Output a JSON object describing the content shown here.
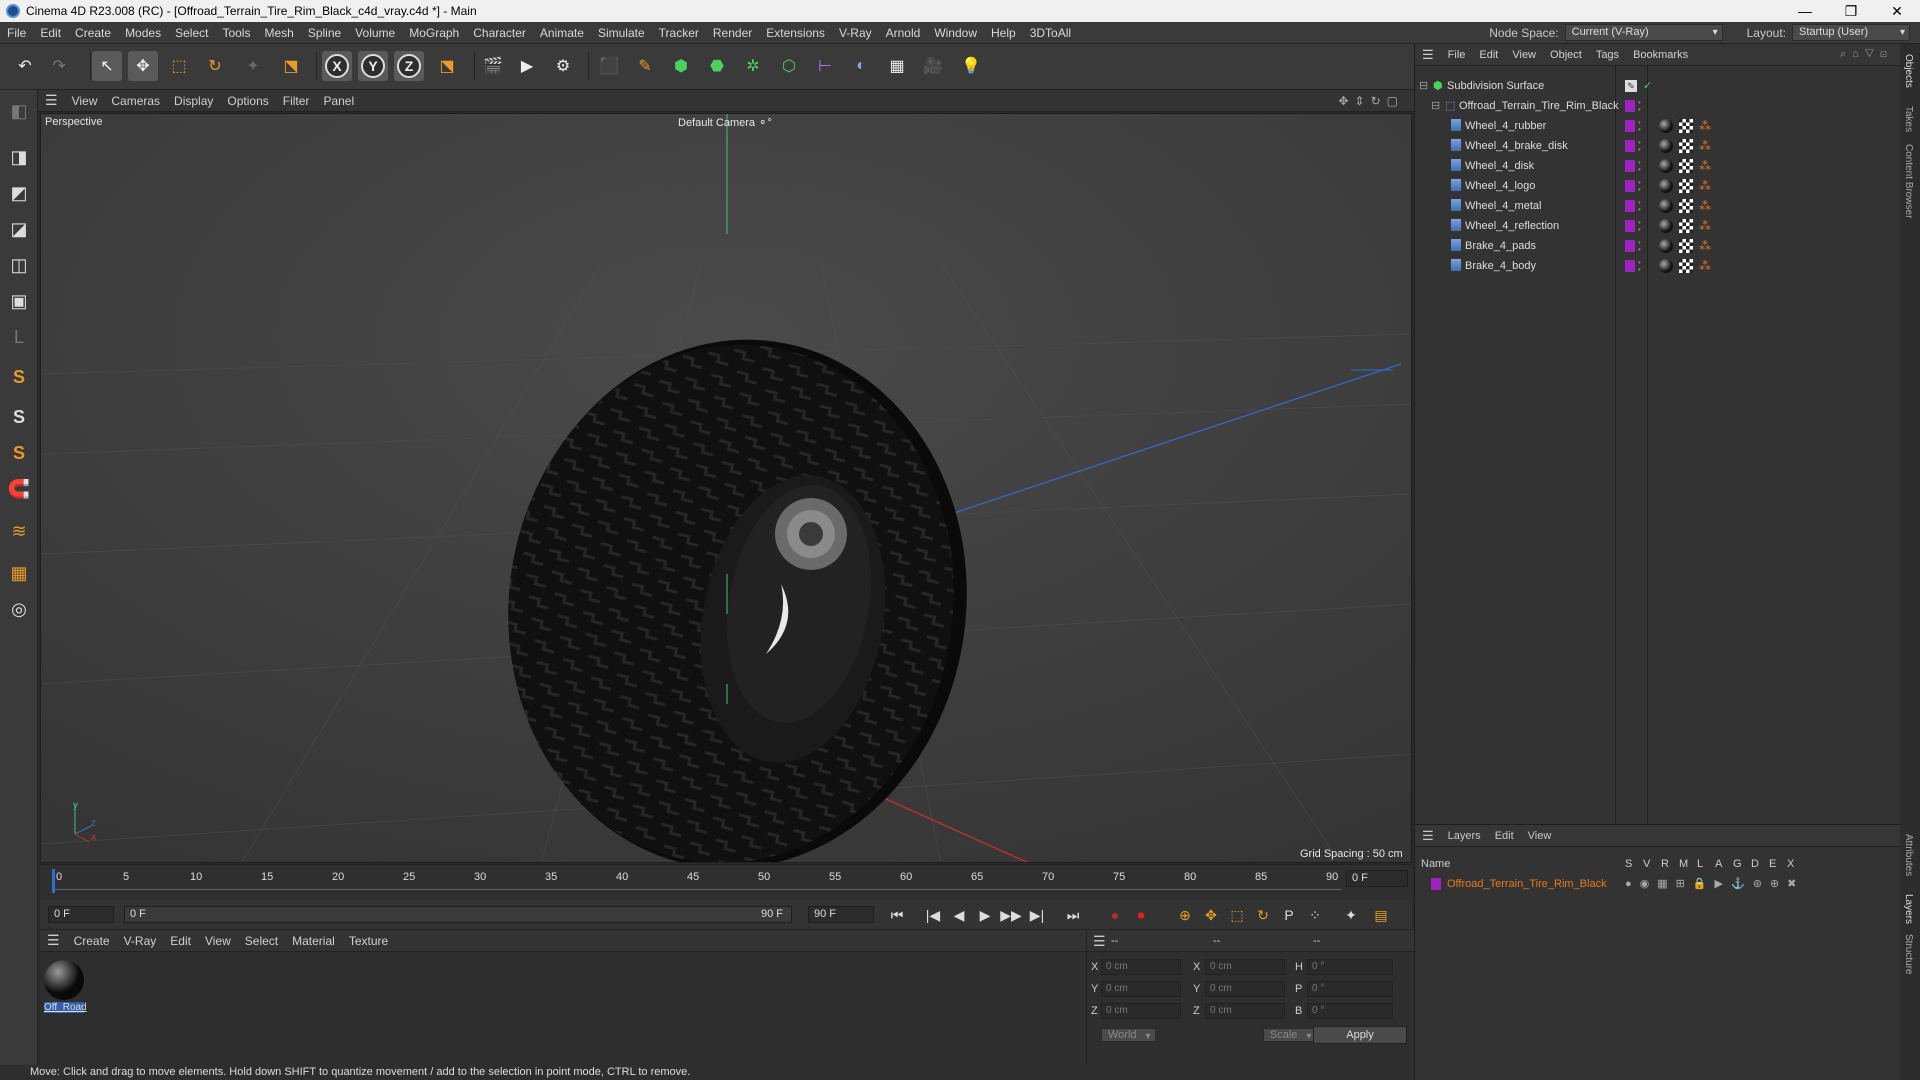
{
  "titlebar": {
    "title": "Cinema 4D R23.008 (RC) - [Offroad_Terrain_Tire_Rim_Black_c4d_vray.c4d *] - Main",
    "minimize": "—",
    "maximize": "❐",
    "close": "✕"
  },
  "menu": {
    "items": [
      "File",
      "Edit",
      "Create",
      "Modes",
      "Select",
      "Tools",
      "Mesh",
      "Spline",
      "Volume",
      "MoGraph",
      "Character",
      "Animate",
      "Simulate",
      "Tracker",
      "Render",
      "Extensions",
      "V-Ray",
      "Arnold",
      "Window",
      "Help",
      "3DToAll"
    ],
    "node_space_label": "Node Space:",
    "node_space_value": "Current (V-Ray)",
    "layout_label": "Layout:",
    "layout_value": "Startup (User)"
  },
  "toolbar": {
    "undo": "↶",
    "redo": "↷",
    "select": "↖",
    "move": "✥",
    "scale": "⬚",
    "rotate": "↻",
    "recent": "✦",
    "axis_x": "X",
    "axis_y": "Y",
    "axis_z": "Z",
    "coord": "⬔",
    "render_view": "🎬",
    "render_pic": "▶",
    "render_settings": "⚙",
    "cube": "⬛",
    "pen": "✎",
    "subdiv": "⬢",
    "extrude": "⬣",
    "cloner": "✲",
    "generators": "⬡",
    "deformer": "⊢",
    "field": "◐",
    "floor": "▦",
    "camera": "🎥",
    "light": "💡"
  },
  "lefttools": [
    "◧",
    "◨",
    "◩",
    "◪",
    "◫",
    "▣",
    "L",
    "S",
    "S",
    "S",
    "🧲",
    "≋",
    "▦",
    "◎"
  ],
  "viewport": {
    "menu": [
      "View",
      "Cameras",
      "Display",
      "Options",
      "Filter",
      "Panel"
    ],
    "label": "Perspective",
    "camera": "Default Camera",
    "camera_icon": "⚬°",
    "grid_spacing": "Grid Spacing : 50 cm",
    "axis_y": "y",
    "axis_z": "z",
    "axis_x": "x"
  },
  "timeline": {
    "ticks": [
      "0",
      "5",
      "10",
      "15",
      "20",
      "25",
      "30",
      "35",
      "40",
      "45",
      "50",
      "55",
      "60",
      "65",
      "70",
      "75",
      "80",
      "85",
      "90"
    ],
    "current_frame_right": "0 F",
    "start": "0 F",
    "range_start": "0 F",
    "range_end": "90 F",
    "end": "90 F"
  },
  "playbar": {
    "first": "⏮",
    "prev_key": "|◀",
    "prev": "◀",
    "play": "▶",
    "next": "▶|",
    "next_key": "▶▶",
    "last": "⏭",
    "record_auto": "●",
    "record": "⏺",
    "keys": [
      "⊕",
      "✥",
      "⬚",
      "↻",
      "P",
      "⁘"
    ],
    "options": [
      "✦",
      "▤"
    ]
  },
  "materials": {
    "menu": [
      "Create",
      "V-Ray",
      "Edit",
      "View",
      "Select",
      "Material",
      "Texture"
    ],
    "items": [
      {
        "name": "Off_Road"
      }
    ]
  },
  "coords": {
    "header": [
      "--",
      "--",
      "--"
    ],
    "rows": [
      {
        "a": "X",
        "av": "0 cm",
        "b": "X",
        "bv": "0 cm",
        "c": "H",
        "cv": "0 °"
      },
      {
        "a": "Y",
        "av": "0 cm",
        "b": "Y",
        "bv": "0 cm",
        "c": "P",
        "cv": "0 °"
      },
      {
        "a": "Z",
        "av": "0 cm",
        "b": "Z",
        "bv": "0 cm",
        "c": "B",
        "cv": "0 °"
      }
    ],
    "space": "World",
    "mode": "Scale",
    "apply": "Apply"
  },
  "status": "Move: Click and drag to move elements. Hold down SHIFT to quantize movement / add to the selection in point mode, CTRL to remove.",
  "objects": {
    "menu": [
      "File",
      "Edit",
      "View",
      "Object",
      "Tags",
      "Bookmarks"
    ],
    "tree": [
      {
        "name": "Subdivision Surface",
        "level": 0
      },
      {
        "name": "Offroad_Terrain_Tire_Rim_Black",
        "level": 1
      },
      {
        "name": "Wheel_4_rubber",
        "level": 2
      },
      {
        "name": "Wheel_4_brake_disk",
        "level": 2
      },
      {
        "name": "Wheel_4_disk",
        "level": 2
      },
      {
        "name": "Wheel_4_logo",
        "level": 2
      },
      {
        "name": "Wheel_4_metal",
        "level": 2
      },
      {
        "name": "Wheel_4_reflection",
        "level": 2
      },
      {
        "name": "Brake_4_pads",
        "level": 2
      },
      {
        "name": "Brake_4_body",
        "level": 2
      }
    ]
  },
  "layers": {
    "menu": [
      "Layers",
      "Edit",
      "View"
    ],
    "header_name": "Name",
    "columns": [
      "S",
      "V",
      "R",
      "M",
      "L",
      "A",
      "G",
      "D",
      "E",
      "X"
    ],
    "rows": [
      {
        "name": "Offroad_Terrain_Tire_Rim_Black",
        "color": "#a020c0"
      }
    ]
  },
  "sidetabs": [
    "Objects",
    "Takes",
    "Content Browser",
    "Attributes",
    "Layers",
    "Structure"
  ],
  "colors": {
    "accent": "#e87a1a",
    "layer": "#a020c0",
    "selected": "#5a5a5a"
  }
}
